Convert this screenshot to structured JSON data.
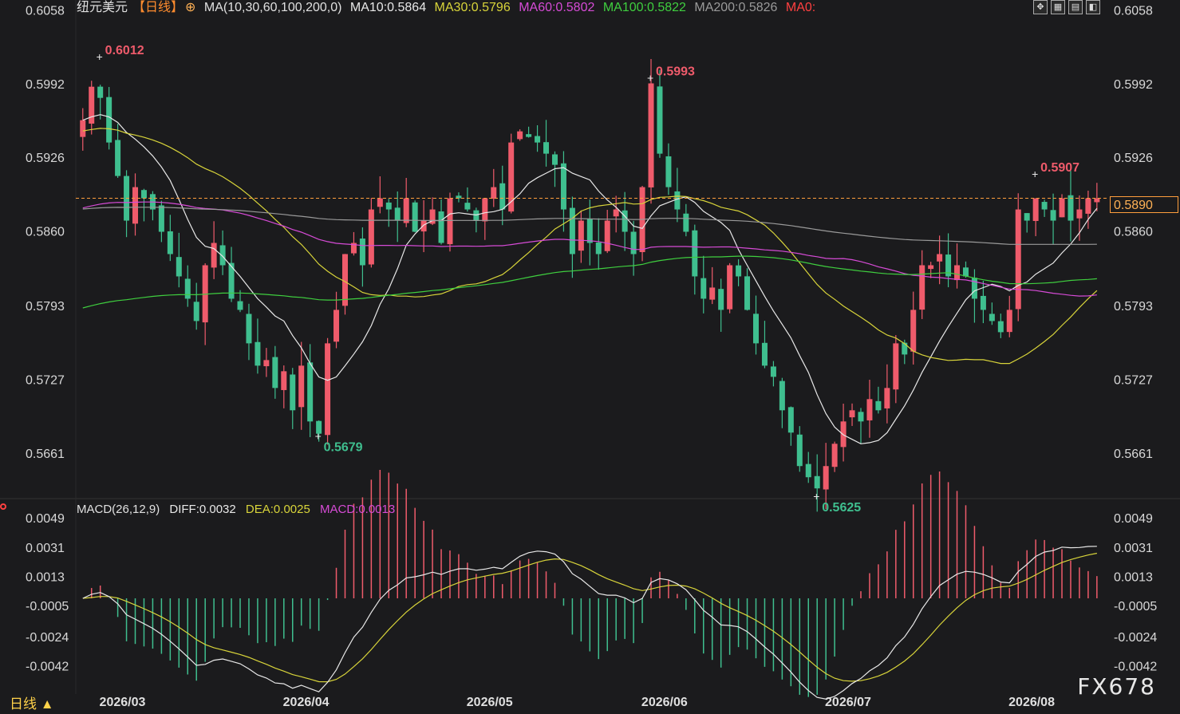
{
  "header": {
    "symbol": "纽元美元",
    "period_tag": "【日线】",
    "ma_params": "MA(10,30,60,100,200,0)",
    "ma10": "MA10:0.5864",
    "ma30": "MA30:0.5796",
    "ma60": "MA60:0.5802",
    "ma100": "MA100:0.5822",
    "ma200": "MA200:0.5826",
    "ma0": "MA0:",
    "toolbar_icons": [
      "expand-icon",
      "layout-icon",
      "chart-icon",
      "panel-icon"
    ]
  },
  "macd_header": {
    "params": "MACD(26,12,9)",
    "diff": "DIFF:0.0032",
    "dea": "DEA:0.0025",
    "macd": "MACD:0.0013"
  },
  "footer": {
    "period_label": "日线 ▲",
    "watermark": "FX678"
  },
  "last_price_label": "0.5890",
  "colors": {
    "up": "#ef5b6b",
    "down": "#3fbf8f",
    "ma10": "#e8e8e8",
    "ma30": "#d8d43a",
    "ma60": "#d64bd6",
    "ma100": "#3fcf3f",
    "ma200": "#9a9a9a",
    "dea": "#d8d43a",
    "diff": "#e8e8e8"
  },
  "chart_data": {
    "type": "candlestick",
    "x_ticks": [
      "2026/03",
      "2026/04",
      "2026/05",
      "2026/06",
      "2026/07",
      "2026/08"
    ],
    "x_tick_index": [
      5,
      26,
      47,
      67,
      88,
      109
    ],
    "price_ticks": [
      "0.6058",
      "0.5992",
      "0.5926",
      "0.5860",
      "0.5793",
      "0.5727",
      "0.5661"
    ],
    "price_range": [
      0.5628,
      0.6062
    ],
    "annotations": [
      {
        "text": "0.6012",
        "index": 2,
        "value": 0.6012,
        "kind": "high"
      },
      {
        "text": "0.5679",
        "index": 27,
        "value": 0.5679,
        "kind": "low"
      },
      {
        "text": "0.5993",
        "index": 65,
        "value": 0.5993,
        "kind": "high"
      },
      {
        "text": "0.5625",
        "index": 84,
        "value": 0.5625,
        "kind": "low"
      },
      {
        "text": "0.5907",
        "index": 109,
        "value": 0.5907,
        "kind": "high"
      }
    ],
    "last_price": 0.589,
    "close_path": [
      0.596,
      0.599,
      0.598,
      0.594,
      0.591,
      0.587,
      0.59,
      0.589,
      0.588,
      0.586,
      0.584,
      0.582,
      0.58,
      0.578,
      0.583,
      0.585,
      0.583,
      0.58,
      0.579,
      0.576,
      0.574,
      0.5745,
      0.572,
      0.5735,
      0.57,
      0.574,
      0.569,
      0.5679,
      0.576,
      0.579,
      0.584,
      0.585,
      0.583,
      0.588,
      0.589,
      0.588,
      0.587,
      0.589,
      0.586,
      0.587,
      0.588,
      0.585,
      0.589,
      0.589,
      0.588,
      0.587,
      0.589,
      0.59,
      0.588,
      0.594,
      0.595,
      0.5945,
      0.594,
      0.593,
      0.592,
      0.588,
      0.584,
      0.587,
      0.585,
      0.584,
      0.587,
      0.588,
      0.586,
      0.584,
      0.59,
      0.5993,
      0.593,
      0.59,
      0.588,
      0.586,
      0.582,
      0.58,
      0.581,
      0.579,
      0.583,
      0.582,
      0.579,
      0.576,
      0.574,
      0.573,
      0.57,
      0.568,
      0.565,
      0.564,
      0.563,
      0.565,
      0.567,
      0.569,
      0.57,
      0.569,
      0.571,
      0.57,
      0.572,
      0.576,
      0.575,
      0.579,
      0.583,
      0.583,
      0.584,
      0.582,
      0.583,
      0.582,
      0.58,
      0.579,
      0.578,
      0.577,
      0.579,
      0.588,
      0.587,
      0.589,
      0.588,
      0.587,
      0.589,
      0.587,
      0.588,
      0.589,
      0.589
    ],
    "macd_ticks": [
      "0.0049",
      "0.0031",
      "0.0013",
      "-0.0005",
      "-0.0024",
      "-0.0042"
    ],
    "macd_range": [
      -0.0054,
      0.0054
    ],
    "macd_latest": {
      "diff": 0.0032,
      "dea": 0.0025,
      "macd": 0.0013
    }
  }
}
